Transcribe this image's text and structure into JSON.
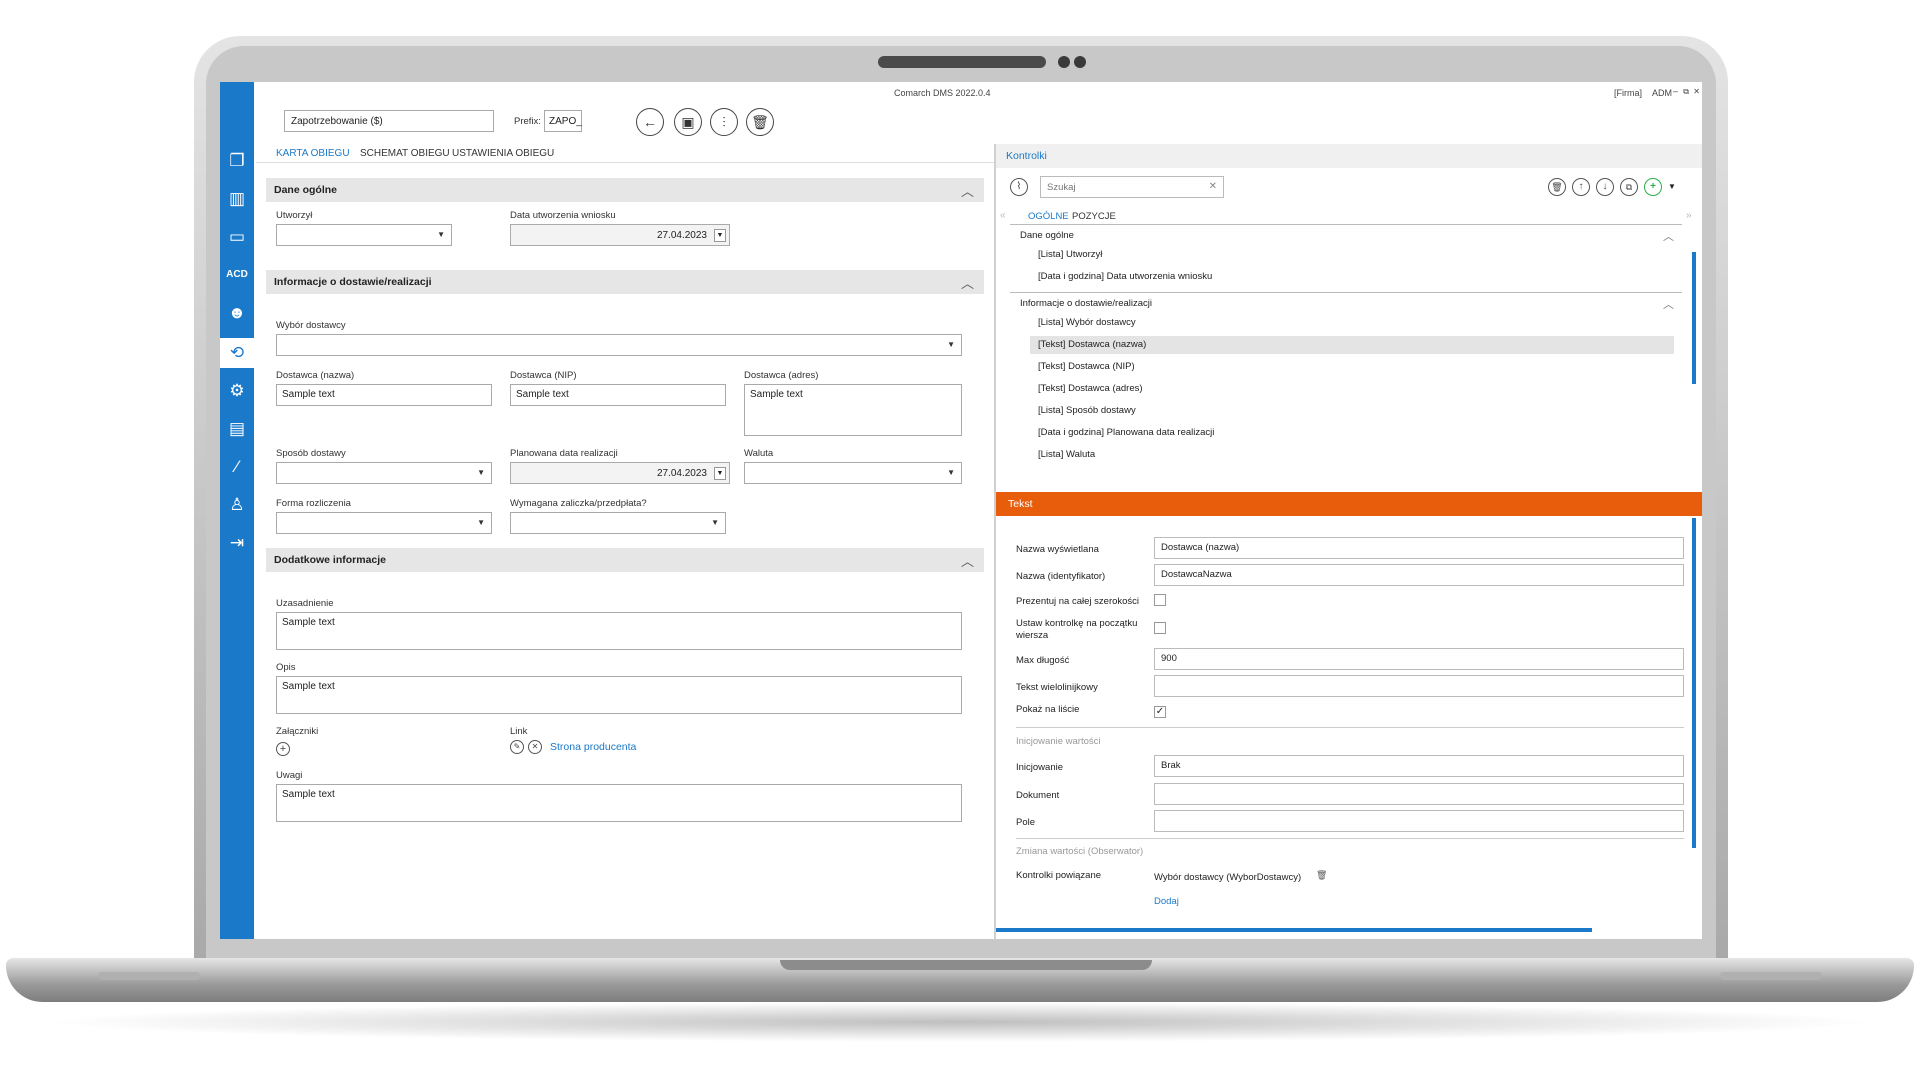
{
  "window": {
    "app_title": "Comarch DMS 2022.0.4",
    "company": "[Firma]",
    "user": "ADM",
    "minimize": "–",
    "restore": "⧉",
    "close": "✕"
  },
  "header": {
    "name_value": "Zapotrzebowanie ($)",
    "prefix_label": "Prefix:",
    "prefix_value": "ZAPO_"
  },
  "tabs": [
    "KARTA OBIEGU",
    "SCHEMAT OBIEGU",
    "USTAWIENIA OBIEGU"
  ],
  "sections": {
    "general": {
      "title": "Dane ogólne",
      "created_by_label": "Utworzył",
      "created_date_label": "Data utworzenia wniosku",
      "created_date_value": "27.04.2023"
    },
    "delivery": {
      "title": "Informacje o dostawie/realizacji",
      "supplier_choice_label": "Wybór dostawcy",
      "supplier_name_label": "Dostawca (nazwa)",
      "supplier_name_value": "Sample text",
      "supplier_nip_label": "Dostawca (NIP)",
      "supplier_nip_value": "Sample text",
      "supplier_address_label": "Dostawca (adres)",
      "supplier_address_value": "Sample text",
      "delivery_method_label": "Sposób dostawy",
      "planned_date_label": "Planowana data realizacji",
      "planned_date_value": "27.04.2023",
      "currency_label": "Waluta",
      "payment_form_label": "Forma rozliczenia",
      "advance_label": "Wymagana zaliczka/przedpłata?"
    },
    "additional": {
      "title": "Dodatkowe informacje",
      "justification_label": "Uzasadnienie",
      "justification_value": "Sample text",
      "description_label": "Opis",
      "description_value": "Sample text",
      "attachments_label": "Załączniki",
      "link_label": "Link",
      "link_text": "Strona producenta",
      "notes_label": "Uwagi",
      "notes_value": "Sample text"
    }
  },
  "controls_panel": {
    "title": "Kontrolki",
    "search_placeholder": "Szukaj",
    "subtabs": [
      "OGÓLNE",
      "POZYCJE"
    ],
    "groups": [
      {
        "name": "Dane ogólne",
        "items": [
          "[Lista] Utworzył",
          "[Data i godzina] Data utworzenia wniosku"
        ]
      },
      {
        "name": "Informacje o dostawie/realizacji",
        "items": [
          "[Lista] Wybór dostawcy",
          "[Tekst] Dostawca (nazwa)",
          "[Tekst] Dostawca (NIP)",
          "[Tekst] Dostawca (adres)",
          "[Lista] Sposób dostawy",
          "[Data i godzina] Planowana data realizacji",
          "[Lista] Waluta"
        ]
      }
    ]
  },
  "properties": {
    "title": "Tekst",
    "display_name_label": "Nazwa wyświetlana",
    "display_name_value": "Dostawca (nazwa)",
    "identifier_label": "Nazwa (identyfikator)",
    "identifier_value": "DostawcaNazwa",
    "full_width_label": "Prezentuj na całej szerokości",
    "row_start_label": "Ustaw kontrolkę na początku wiersza",
    "max_length_label": "Max długość",
    "max_length_value": "900",
    "multiline_label": "Tekst wielolinijkowy",
    "show_on_list_label": "Pokaż na liście",
    "init_section": "Inicjowanie wartości",
    "init_label": "Inicjowanie",
    "init_value": "Brak",
    "document_label": "Dokument",
    "field_label": "Pole",
    "observer_section": "Zmiana wartości (Obserwator)",
    "linked_label": "Kontrolki powiązane",
    "linked_value": "Wybór dostawcy (WyborDostawcy)",
    "add_link": "Dodaj"
  },
  "colors": {
    "accent": "#1b79c9",
    "orange": "#e85d0c"
  }
}
